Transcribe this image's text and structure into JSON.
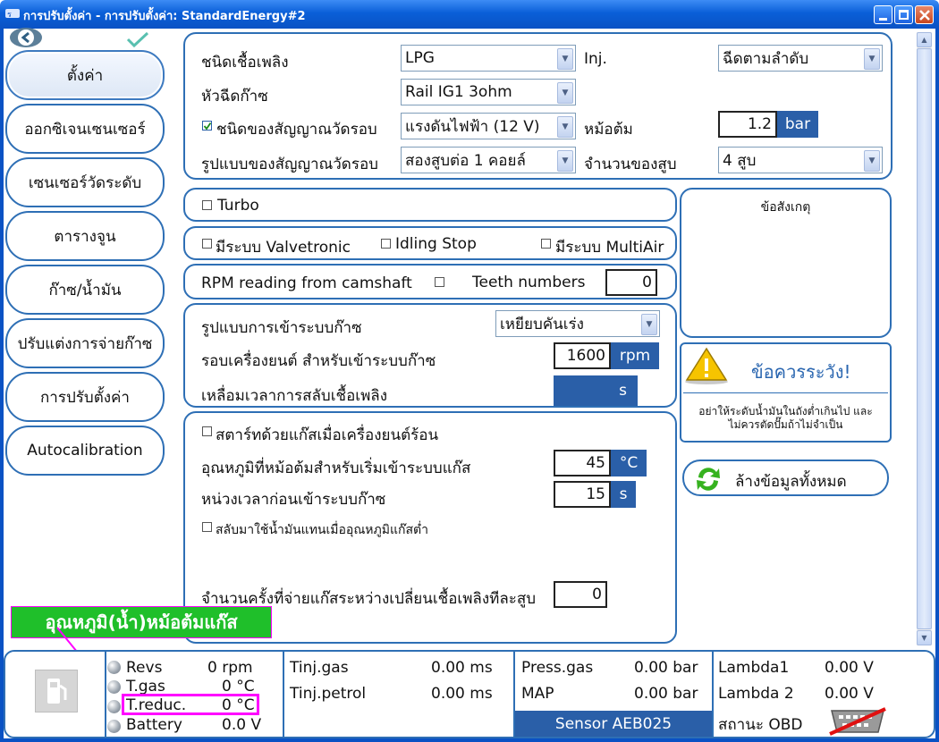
{
  "window": {
    "title": "การปรับตั้งค่า - การปรับตั้งค่า: StandardEnergy#2"
  },
  "sidebar": {
    "items": [
      {
        "label": "ตั้งค่า"
      },
      {
        "label": "ออกซิเจนเซนเซอร์"
      },
      {
        "label": "เซนเซอร์วัดระดับ"
      },
      {
        "label": "ตารางจูน"
      },
      {
        "label": "ก๊าซ/น้ำมัน"
      },
      {
        "label": "ปรับแต่งการจ่ายก๊าซ"
      },
      {
        "label": "การปรับตั้งค่า"
      },
      {
        "label": "Autocalibration"
      }
    ]
  },
  "fuel": {
    "fuel_type_label": "ชนิดเชื้อเพลิง",
    "fuel_type_value": "LPG",
    "inj_label": "Inj.",
    "inj_value": "ฉีดตามลำดับ",
    "injector_label": "หัวฉีดก๊าซ",
    "injector_value": "Rail IG1 3ohm",
    "rpm_signal_label": "ชนิดของสัญญาณวัดรอบ",
    "rpm_signal_value": "แรงดันไฟฟ้า (12 V)",
    "reducer_label": "หม้อต้ม",
    "reducer_value": "1.2",
    "reducer_unit": "bar",
    "signal_pattern_label": "รูปแบบของสัญญาณวัดรอบ",
    "signal_pattern_value": "สองสูบต่อ 1 คอยล์",
    "cylinders_label": "จำนวนของสูบ",
    "cylinders_value": "4 สูบ"
  },
  "turbo": {
    "label": "Turbo"
  },
  "options": {
    "valvetronic": "มีระบบ Valvetronic",
    "idling_stop": "Idling Stop",
    "multiair": "มีระบบ MultiAir"
  },
  "rpm_cam": {
    "label": "RPM reading from camshaft",
    "teeth_label": "Teeth numbers",
    "teeth_value": "0"
  },
  "switch": {
    "mode_label": "รูปแบบการเข้าระบบก๊าซ",
    "mode_value": "เหยียบคันเร่ง",
    "rpm_label": "รอบเครื่องยนต์ สำหรับเข้าระบบก๊าซ",
    "rpm_value": "1600",
    "rpm_unit": "rpm",
    "overlap_label": "เหลื่อมเวลาการสลับเชื้อเพลิง",
    "overlap_unit": "s"
  },
  "temp": {
    "hot_start_label": "สตาร์ทด้วยแก๊สเมื่อเครื่องยนต์ร้อน",
    "reducer_temp_label": "อุณหภูมิที่หม้อต้มสำหรับเริ่มเข้าระบบแก๊ส",
    "reducer_temp_value": "45",
    "reducer_temp_unit": "°C",
    "delay_label": "หน่วงเวลาก่อนเข้าระบบก๊าซ",
    "delay_value": "15",
    "delay_unit": "s",
    "low_temp_label": "สลับมาใช้น้ำมันแทนเมื่ออุณหภูมิแก๊สต่ำ",
    "cycles_label": "จำนวนครั้งที่จ่ายแก๊สระหว่างเปลี่ยนเชื้อเพลิงทีละสูบ",
    "cycles_value": "0"
  },
  "notes": {
    "title": "ข้อสังเกตุ"
  },
  "warning": {
    "title": "ข้อควรระวัง!",
    "text_line1": "อย่าให้ระดับน้ำมันในถังต่ำเกินไป และ",
    "text_line2": "ไม่ควรตัดปั๊มถ้าไม่จำเป็น"
  },
  "clear_button": {
    "label": "ล้างข้อมูลทั้งหมด"
  },
  "annotation": {
    "label": "อุณหภูมิ(น้ำ)หม้อต้มแก๊ส"
  },
  "status": {
    "revs_label": "Revs",
    "revs_value": "0 rpm",
    "tgas_label": "T.gas",
    "tgas_value": "0 °C",
    "treduc_label": "T.reduc.",
    "treduc_value": "0 °C",
    "battery_label": "Battery",
    "battery_value": "0.0 V",
    "tinj_gas_label": "Tinj.gas",
    "tinj_gas_value": "0.00 ms",
    "tinj_petrol_label": "Tinj.petrol",
    "tinj_petrol_value": "0.00 ms",
    "press_gas_label": "Press.gas",
    "press_gas_value": "0.00 bar",
    "map_label": "MAP",
    "map_value": "0.00 bar",
    "sensor_label": "Sensor AEB025",
    "lambda1_label": "Lambda1",
    "lambda1_value": "0.00 V",
    "lambda2_label": "Lambda 2",
    "lambda2_value": "0.00 V",
    "obd_label": "สถานะ OBD"
  },
  "colors": {
    "accent": "#2e6fb5",
    "unit_box": "#2a5fa8",
    "annotation_green": "#1fbf2a",
    "annotation_magenta": "#ff00ff"
  }
}
